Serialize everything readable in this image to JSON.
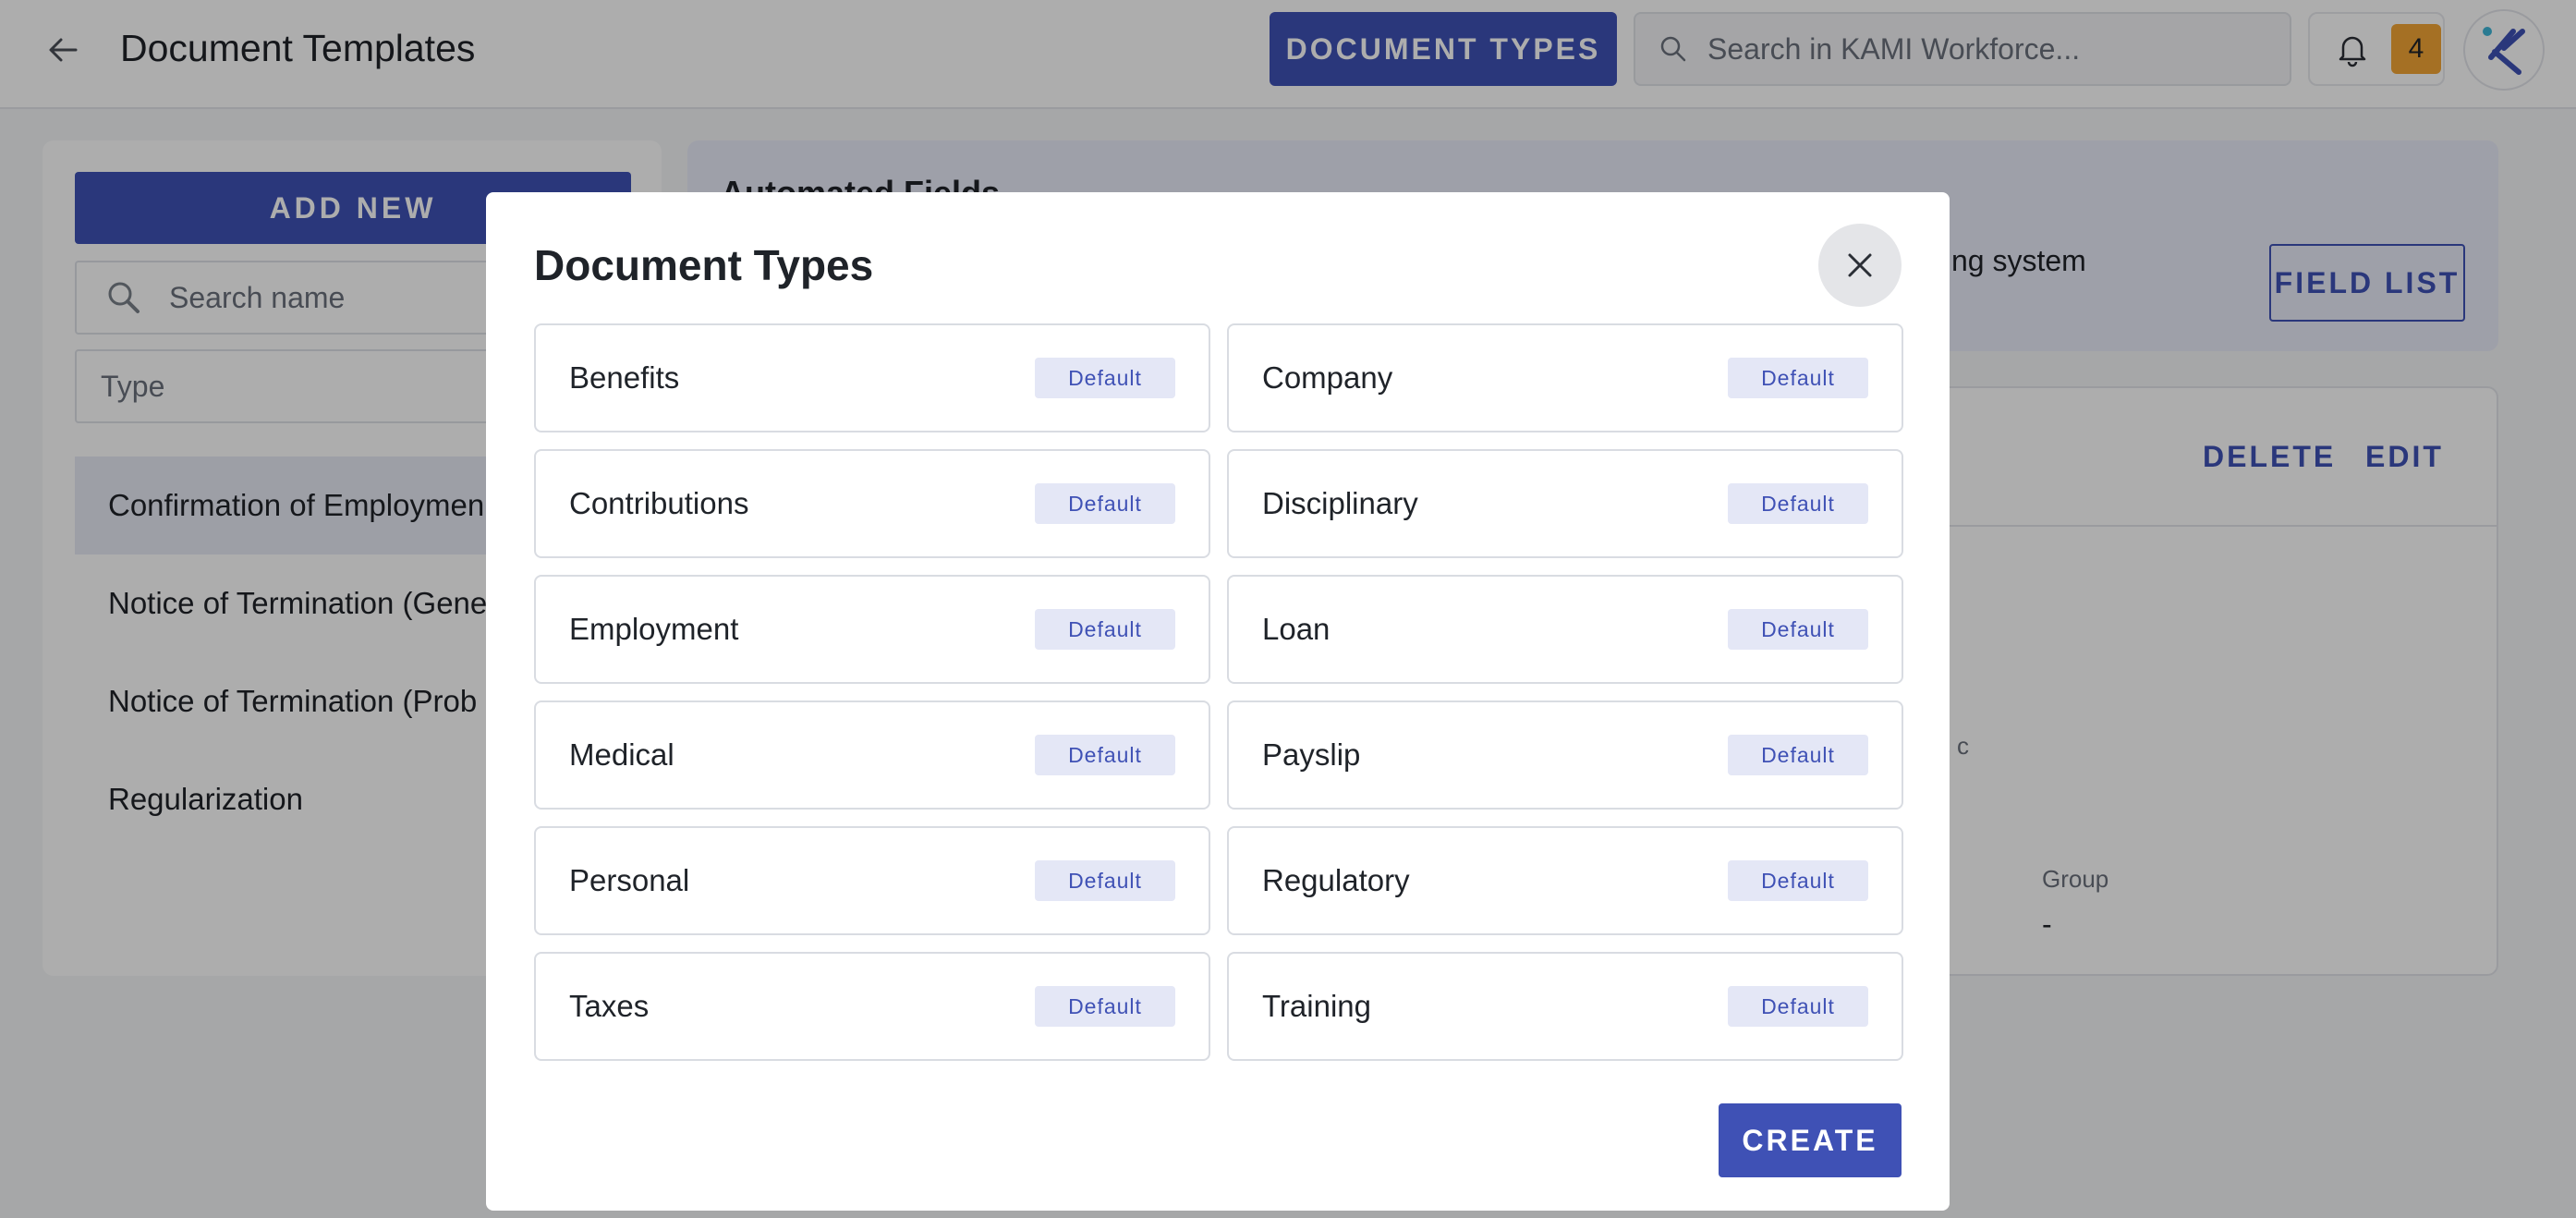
{
  "header": {
    "title": "Document Templates",
    "document_types_label": "DOCUMENT TYPES",
    "search_placeholder": "Search in KAMI Workforce...",
    "notification_count": "4"
  },
  "sidebar": {
    "add_new_label": "ADD NEW",
    "search_placeholder": "Search name",
    "type_filter_placeholder": "Type",
    "templates": [
      {
        "name": "Confirmation of Employmen",
        "active": true
      },
      {
        "name": "Notice of Termination (Gene",
        "active": false
      },
      {
        "name": "Notice of Termination (Prob",
        "active": false
      },
      {
        "name": "Regularization",
        "active": false
      }
    ]
  },
  "automated_fields": {
    "title": "Automated Fields",
    "description_fragment": "ting system",
    "field_list_label": "FIELD LIST"
  },
  "detail": {
    "delete_label": "DELETE",
    "edit_label": "EDIT",
    "fragment_c": "c",
    "group_label": "Group",
    "group_value": "-"
  },
  "modal": {
    "title": "Document Types",
    "create_label": "CREATE",
    "badge_label": "Default",
    "types": [
      {
        "name": "Benefits",
        "badge": "Default"
      },
      {
        "name": "Company",
        "badge": "Default"
      },
      {
        "name": "Contributions",
        "badge": "Default"
      },
      {
        "name": "Disciplinary",
        "badge": "Default"
      },
      {
        "name": "Employment",
        "badge": "Default"
      },
      {
        "name": "Loan",
        "badge": "Default"
      },
      {
        "name": "Medical",
        "badge": "Default"
      },
      {
        "name": "Payslip",
        "badge": "Default"
      },
      {
        "name": "Personal",
        "badge": "Default"
      },
      {
        "name": "Regulatory",
        "badge": "Default"
      },
      {
        "name": "Taxes",
        "badge": "Default"
      },
      {
        "name": "Training",
        "badge": "Default"
      }
    ]
  },
  "colors": {
    "primary": "#3f51b5",
    "badge_bg": "#e4e7f6",
    "notification": "#f3a536",
    "overlay": "rgba(0,0,0,0.32)"
  },
  "icons": [
    "back-arrow-icon",
    "search-icon",
    "bell-icon",
    "kami-logo-icon",
    "close-icon"
  ]
}
